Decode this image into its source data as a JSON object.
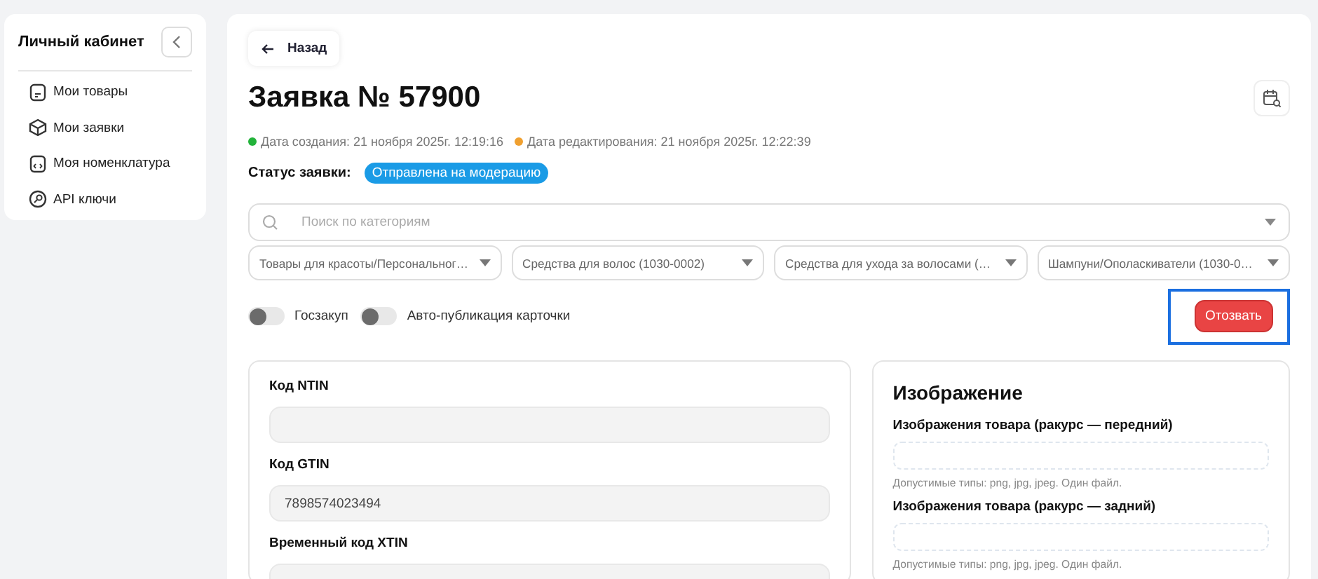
{
  "sidebar": {
    "title": "Личный кабинет",
    "items": [
      {
        "label": "Мои товары"
      },
      {
        "label": "Мои заявки"
      },
      {
        "label": "Моя номенклатура"
      },
      {
        "label": "API ключи"
      }
    ]
  },
  "back": {
    "label": "Назад"
  },
  "title": "Заявка № 57900",
  "dates": [
    {
      "text": "Дата создания: 21 ноября 2025г. 12:19:16",
      "color": "#22b33a"
    },
    {
      "text": "Дата редактирования: 21 ноября 2025г. 12:22:39",
      "color": "#f0a030"
    }
  ],
  "status": {
    "label": "Статус заявки:",
    "badge": "Отправлена на модерацию"
  },
  "search": {
    "placeholder": "Поиск по категориям"
  },
  "categories": [
    "Товары для красоты/Персональног…",
    "Средства для волос (1030-0002)",
    "Средства для ухода за волосами (…",
    "Шампуни/Ополаскиватели (1030-0…"
  ],
  "toggles": [
    {
      "label": "Госзакуп",
      "on": false
    },
    {
      "label": "Авто-публикация карточки",
      "on": false
    }
  ],
  "revoke_button": {
    "label": "Отозвать",
    "highlighted": true
  },
  "codes": [
    {
      "label": "Код NTIN"
    },
    {
      "label": "Код GTIN",
      "value": "7898574023494"
    },
    {
      "label": "Временный код XTIN"
    }
  ],
  "images": {
    "title": "Изображение",
    "fields": [
      {
        "label": "Изображения товара (ракурс — передний)",
        "hint": "Допустимые типы: png, jpg, jpeg. Один файл."
      },
      {
        "label": "Изображения товара (ракурс — задний)",
        "hint": "Допустимые типы: png, jpg, jpeg. Один файл."
      }
    ]
  }
}
